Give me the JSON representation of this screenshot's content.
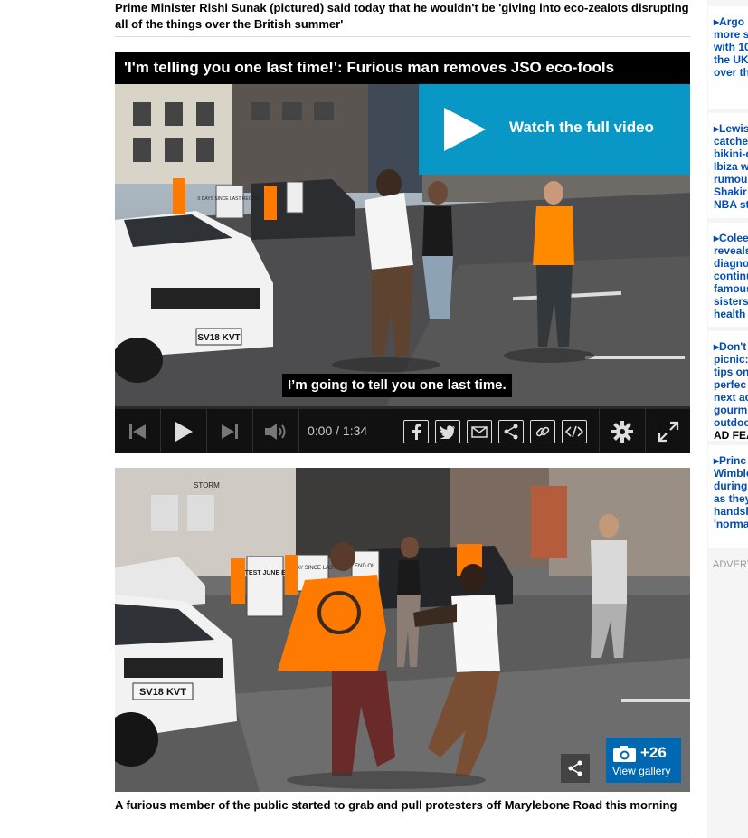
{
  "top_caption": "Prime Minister Rishi Sunak (pictured) said today that he wouldn't be 'giving into eco-zealots disrupting all of the things over the British summer'",
  "video": {
    "title": "'I'm telling you one last time!': Furious man removes JSO eco-fools",
    "watch_label": "Watch the full video",
    "subtitle": "I’m going to tell you one last time.",
    "time": "0:00 / 1:34",
    "progress": 0,
    "plate": "SV18 KVT",
    "placard_1": "0 DAYS SINCE LAST RECORD"
  },
  "photo": {
    "gallery_count": "+26",
    "gallery_label": "View gallery",
    "plate": "SV18 KVT",
    "placard_hottest": "HOTTEST JUNE EVER",
    "placard_days": "0 DAY SINCE LAST",
    "placard_end": "END OIL",
    "shop_sign": "STORM"
  },
  "bottom_caption": "A furious member of the public started to grab and pull protesters off Marylebone Road this morning",
  "sidebar": {
    "items": [
      {
        "text": "Argo\nmore s\nwith 10\nthe UK\nover th"
      },
      {
        "text": "Lewis\ncatche\nbikini-c\nIbiza w\nrumou\nShakir\nNBA st"
      },
      {
        "text": "Colee\nreveals\ndiagno\ncontinu\nfamous\nsisters\nhealth"
      },
      {
        "text": "Don't\npicnic:\ntips on\nperfec\nnext ac\ngourm\noutdoo",
        "tag": "AD FEA"
      },
      {
        "text": "Princ\nWimble\nduring\nas they\nhandsh\n'norma"
      }
    ],
    "advert_label": "ADVERT"
  }
}
